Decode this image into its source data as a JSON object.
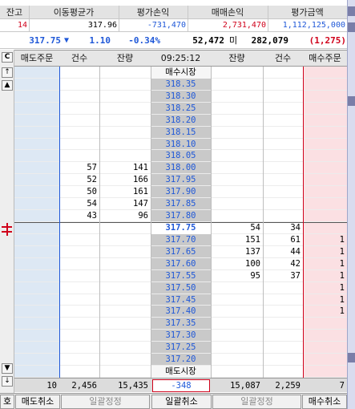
{
  "summary": {
    "headers": [
      "잔고",
      "이동평균가",
      "평가손익",
      "매매손익",
      "평가금액"
    ],
    "values": [
      "14",
      "317.96",
      "-731,470",
      "2,731,470",
      "1,112,125,000"
    ]
  },
  "price_bar": {
    "current_price": "317.75",
    "arrow": "▼",
    "change": "1.10",
    "change_pct": "-0.34%",
    "volume": "52,472",
    "mi_label": "미",
    "open_interest": "282,079",
    "oi_change": "(1,275)"
  },
  "grid_header": {
    "sell_order": "매도주문",
    "sell_count": "건수",
    "sell_qty": "잔량",
    "time": "09:25:12",
    "buy_qty": "잔량",
    "buy_count": "건수",
    "buy_order": "매수주문",
    "c_button": "C"
  },
  "rows": [
    {
      "price": "매수시장",
      "sc": "",
      "sq": "",
      "bq": "",
      "bc": "",
      "bo": ""
    },
    {
      "price": "318.35",
      "sc": "",
      "sq": "",
      "bq": "",
      "bc": "",
      "bo": ""
    },
    {
      "price": "318.30",
      "sc": "",
      "sq": "",
      "bq": "",
      "bc": "",
      "bo": ""
    },
    {
      "price": "318.25",
      "sc": "",
      "sq": "",
      "bq": "",
      "bc": "",
      "bo": ""
    },
    {
      "price": "318.20",
      "sc": "",
      "sq": "",
      "bq": "",
      "bc": "",
      "bo": ""
    },
    {
      "price": "318.15",
      "sc": "",
      "sq": "",
      "bq": "",
      "bc": "",
      "bo": ""
    },
    {
      "price": "318.10",
      "sc": "",
      "sq": "",
      "bq": "",
      "bc": "",
      "bo": ""
    },
    {
      "price": "318.05",
      "sc": "",
      "sq": "",
      "bq": "",
      "bc": "",
      "bo": ""
    },
    {
      "price": "318.00",
      "sc": "57",
      "sq": "141",
      "bq": "",
      "bc": "",
      "bo": ""
    },
    {
      "price": "317.95",
      "sc": "52",
      "sq": "166",
      "bq": "",
      "bc": "",
      "bo": ""
    },
    {
      "price": "317.90",
      "sc": "50",
      "sq": "161",
      "bq": "",
      "bc": "",
      "bo": ""
    },
    {
      "price": "317.85",
      "sc": "54",
      "sq": "147",
      "bq": "",
      "bc": "",
      "bo": ""
    },
    {
      "price": "317.80",
      "sc": "43",
      "sq": "96",
      "bq": "",
      "bc": "",
      "bo": ""
    },
    {
      "price": "317.75",
      "sc": "",
      "sq": "",
      "bq": "54",
      "bc": "34",
      "bo": ""
    },
    {
      "price": "317.70",
      "sc": "",
      "sq": "",
      "bq": "151",
      "bc": "61",
      "bo": "1"
    },
    {
      "price": "317.65",
      "sc": "",
      "sq": "",
      "bq": "137",
      "bc": "44",
      "bo": "1"
    },
    {
      "price": "317.60",
      "sc": "",
      "sq": "",
      "bq": "100",
      "bc": "42",
      "bo": "1"
    },
    {
      "price": "317.55",
      "sc": "",
      "sq": "",
      "bq": "95",
      "bc": "37",
      "bo": "1"
    },
    {
      "price": "317.50",
      "sc": "",
      "sq": "",
      "bq": "",
      "bc": "",
      "bo": "1"
    },
    {
      "price": "317.45",
      "sc": "",
      "sq": "",
      "bq": "",
      "bc": "",
      "bo": "1"
    },
    {
      "price": "317.40",
      "sc": "",
      "sq": "",
      "bq": "",
      "bc": "",
      "bo": "1"
    },
    {
      "price": "317.35",
      "sc": "",
      "sq": "",
      "bq": "",
      "bc": "",
      "bo": ""
    },
    {
      "price": "317.30",
      "sc": "",
      "sq": "",
      "bq": "",
      "bc": "",
      "bo": ""
    },
    {
      "price": "317.25",
      "sc": "",
      "sq": "",
      "bq": "",
      "bc": "",
      "bo": ""
    },
    {
      "price": "317.20",
      "sc": "",
      "sq": "",
      "bq": "",
      "bc": "",
      "bo": ""
    },
    {
      "price": "매도시장",
      "sc": "",
      "sq": "",
      "bq": "",
      "bc": "",
      "bo": ""
    }
  ],
  "totals": {
    "sell_order": "10",
    "sell_count": "2,456",
    "sell_qty": "15,435",
    "diff": "-348",
    "buy_qty": "15,087",
    "buy_count": "2,259",
    "buy_order": "7"
  },
  "bottom": {
    "ho": "호",
    "sell_cancel": "매도취소",
    "bulk_edit_1": "일괄정정",
    "bulk_cancel": "일괄취소",
    "bulk_edit_2": "일괄정정",
    "buy_cancel": "매수취소"
  },
  "colors": {
    "price_blue": "#1f58d8",
    "loss_blue": "#1f58d8",
    "gain_red": "#d0021b",
    "sell_bg": "#dde8f4",
    "buy_bg": "#fbe0e3",
    "price_bg": "#c9c9c9"
  }
}
